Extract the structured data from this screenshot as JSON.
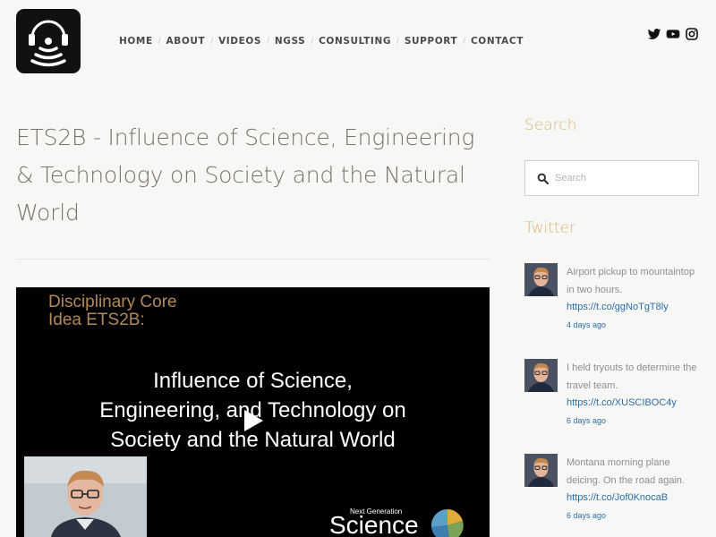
{
  "header": {
    "nav": [
      {
        "label": "HOME"
      },
      {
        "label": "ABOUT"
      },
      {
        "label": "VIDEOS"
      },
      {
        "label": "NGSS"
      },
      {
        "label": "CONSULTING"
      },
      {
        "label": "SUPPORT"
      },
      {
        "label": "CONTACT"
      }
    ],
    "social_icons": [
      "twitter-icon",
      "youtube-icon",
      "instagram-icon"
    ]
  },
  "main": {
    "title": "ETS2B - Influence of Science, Engineering & Technology on Society and the Natural World",
    "video": {
      "core_line1": "Disciplinary Core",
      "core_line2": "Idea ETS2B:",
      "title_lines": [
        "Influence of Science,",
        "Engineering, and Technology on",
        "Society and the Natural World"
      ],
      "brand_small": "Next Generation",
      "brand_big": "Science"
    }
  },
  "sidebar": {
    "search_heading": "Search",
    "search_placeholder": "Search",
    "twitter_heading": "Twitter",
    "tweets": [
      {
        "text": "Airport pickup to mountaintop in two hours.",
        "link": "https://t.co/ggNoTgT8ly",
        "time": "4 days ago"
      },
      {
        "text": "I held tryouts to determine the travel team.",
        "link": "https://t.co/XUSCIBOC4y",
        "time": "6 days ago"
      },
      {
        "text": "Montana morning plane deicing. On the road again.",
        "link": "https://t.co/Jof0KnocaB",
        "time": "6 days ago"
      }
    ]
  },
  "colors": {
    "accent": "#d8b778",
    "link": "#2d6ea8",
    "title": "#7a7167"
  }
}
